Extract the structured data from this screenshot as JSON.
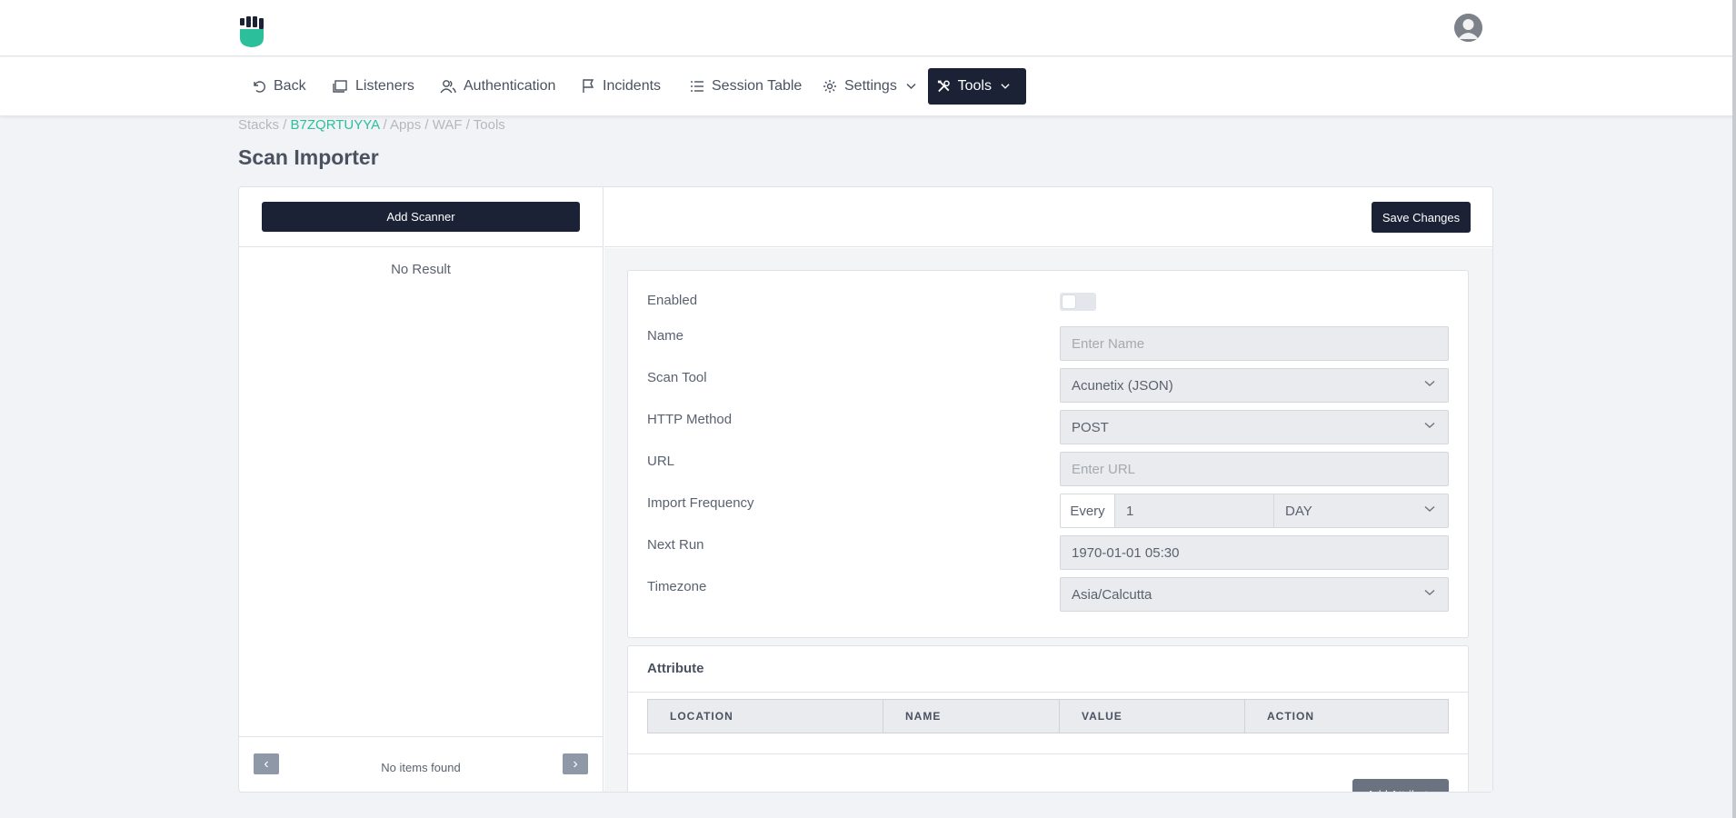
{
  "nav": {
    "items": [
      {
        "label": "Back",
        "icon": "undo-icon"
      },
      {
        "label": "Listeners",
        "icon": "window-icon"
      },
      {
        "label": "Authentication",
        "icon": "users-icon"
      },
      {
        "label": "Incidents",
        "icon": "flag-icon"
      },
      {
        "label": "Session Table",
        "icon": "list-icon"
      },
      {
        "label": "Settings",
        "icon": "gear-icon"
      },
      {
        "label": "Tools",
        "icon": "tools-icon"
      }
    ]
  },
  "breadcrumb": {
    "items": [
      "Stacks",
      "B7ZQRTUYYA",
      "Apps",
      "WAF",
      "Tools"
    ],
    "separator": "/"
  },
  "page": {
    "title": "Scan Importer"
  },
  "left_pane": {
    "add_button": "Add Scanner",
    "empty_text": "No Result",
    "pagination_text": "No items found",
    "prev_icon": "‹",
    "next_icon": "›"
  },
  "toolbar": {
    "save_label": "Save Changes"
  },
  "form": {
    "enabled": {
      "label": "Enabled",
      "value": false
    },
    "name": {
      "label": "Name",
      "placeholder": "Enter Name"
    },
    "scan_tool": {
      "label": "Scan Tool",
      "value": "Acunetix (JSON)"
    },
    "http_method": {
      "label": "HTTP Method",
      "value": "POST"
    },
    "url": {
      "label": "URL",
      "placeholder": "Enter URL"
    },
    "import_frequency": {
      "label": "Import Frequency",
      "prefix": "Every",
      "value": "1",
      "unit": "DAY"
    },
    "next_run": {
      "label": "Next Run",
      "value": "1970-01-01 05:30"
    },
    "timezone": {
      "label": "Timezone",
      "value": "Asia/Calcutta"
    }
  },
  "attribute": {
    "title": "Attribute",
    "columns": [
      "LOCATION",
      "NAME",
      "VALUE",
      "ACTION"
    ],
    "add_button": "Add Attribute"
  },
  "colors": {
    "accent": "#2bbf9b",
    "dark": "#1b2236"
  }
}
